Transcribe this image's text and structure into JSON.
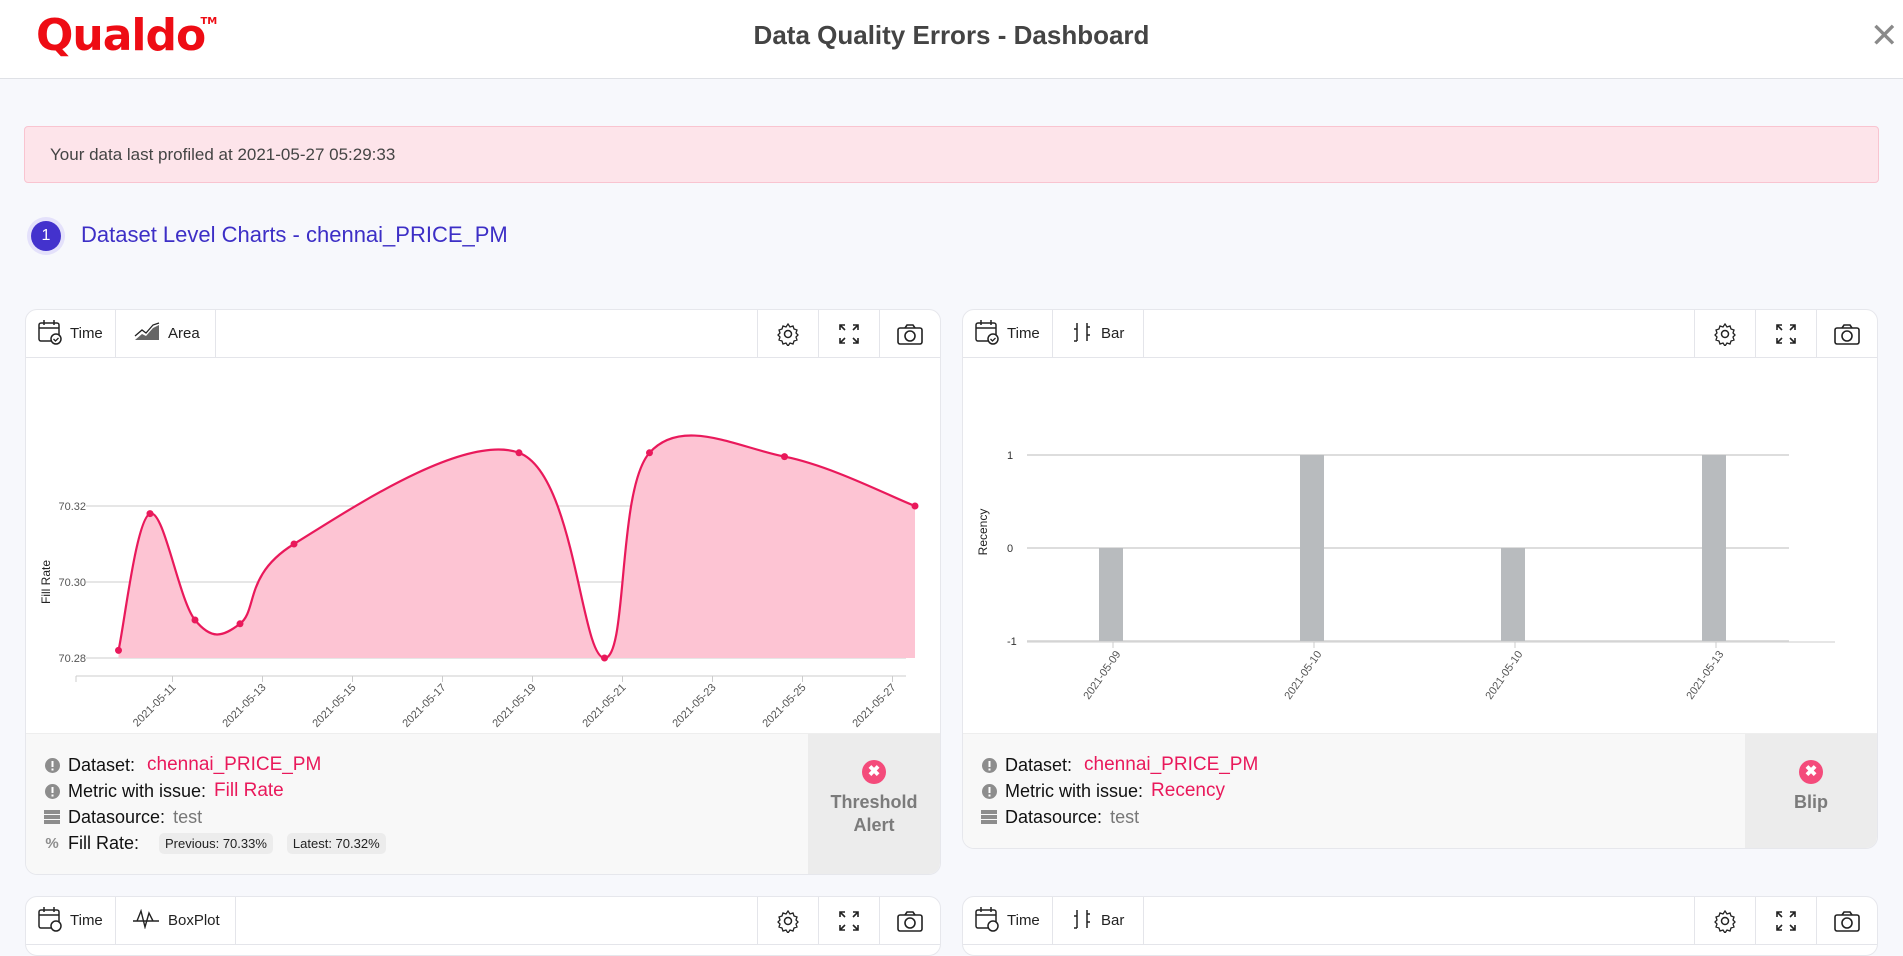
{
  "header": {
    "logo": "Qualdo",
    "logo_tm": "TM",
    "title": "Data Quality Errors - Dashboard",
    "close_icon": "close-icon"
  },
  "alert": {
    "text": "Your data last profiled at 2021-05-27 05:29:33"
  },
  "section": {
    "step": "1",
    "title": "Dataset Level Charts - chennai_PRICE_PM"
  },
  "cards": [
    {
      "toolbar": {
        "time_label": "Time",
        "type_label": "Area",
        "icons": [
          "gear-icon",
          "expand-icon",
          "camera-icon"
        ]
      },
      "info": {
        "dataset_label": "Dataset:",
        "dataset": "chennai_PRICE_PM",
        "metric_label": "Metric with issue:",
        "metric": "Fill Rate",
        "datasource_label": "Datasource:",
        "datasource": "test",
        "extra_label": "Fill Rate:",
        "previous": "Previous: 70.33%",
        "latest": "Latest: 70.32%"
      },
      "status": {
        "line1": "Threshold",
        "line2": "Alert"
      }
    },
    {
      "toolbar": {
        "time_label": "Time",
        "type_label": "Bar",
        "icons": [
          "gear-icon",
          "expand-icon",
          "camera-icon"
        ]
      },
      "info": {
        "dataset_label": "Dataset:",
        "dataset": "chennai_PRICE_PM",
        "metric_label": "Metric with issue:",
        "metric": "Recency",
        "datasource_label": "Datasource:",
        "datasource": "test"
      },
      "status": {
        "line1": "Blip"
      }
    },
    {
      "toolbar": {
        "time_label": "Time",
        "type_label": "BoxPlot"
      }
    },
    {
      "toolbar": {
        "time_label": "Time",
        "type_label": "Bar"
      }
    }
  ],
  "colors": {
    "accent": "#e9195b",
    "area_fill": "#fdc4d3",
    "bar": "#b8bbbe",
    "step": "#4332cd"
  },
  "chart_data": [
    {
      "type": "area",
      "title": "",
      "xlabel": "",
      "ylabel": "Fill Rate",
      "x": [
        "2021-05-09.8",
        "2021-05-10.5",
        "2021-05-11.5",
        "2021-05-12.5",
        "2021-05-13.7",
        "2021-05-18.7",
        "2021-05-20.6",
        "2021-05-21.6",
        "2021-05-24.6",
        "2021-05-27.5"
      ],
      "x_days": [
        9.8,
        10.5,
        11.5,
        12.5,
        13.7,
        18.7,
        20.6,
        21.6,
        24.6,
        27.5
      ],
      "values": [
        70.282,
        70.318,
        70.29,
        70.289,
        70.31,
        70.334,
        70.28,
        70.334,
        70.333,
        70.32
      ],
      "ylim": [
        70.28,
        70.32
      ],
      "yticks": [
        "70.28",
        "70.30",
        "70.32"
      ],
      "xticks": [
        "2021-05-11",
        "2021-05-13",
        "2021-05-15",
        "2021-05-17",
        "2021-05-19",
        "2021-05-21",
        "2021-05-23",
        "2021-05-25",
        "2021-05-27"
      ],
      "xtick_days": [
        11,
        13,
        15,
        17,
        19,
        21,
        23,
        25,
        27
      ],
      "grid": true
    },
    {
      "type": "bar",
      "title": "",
      "xlabel": "",
      "ylabel": "Recency",
      "categories": [
        "2021-05-09",
        "2021-05-10",
        "2021-05-10",
        "2021-05-13"
      ],
      "values": [
        0,
        1,
        0,
        1
      ],
      "ylim": [
        -1,
        1
      ],
      "yticks": [
        "-1",
        "0",
        "1"
      ],
      "grid": true
    }
  ]
}
